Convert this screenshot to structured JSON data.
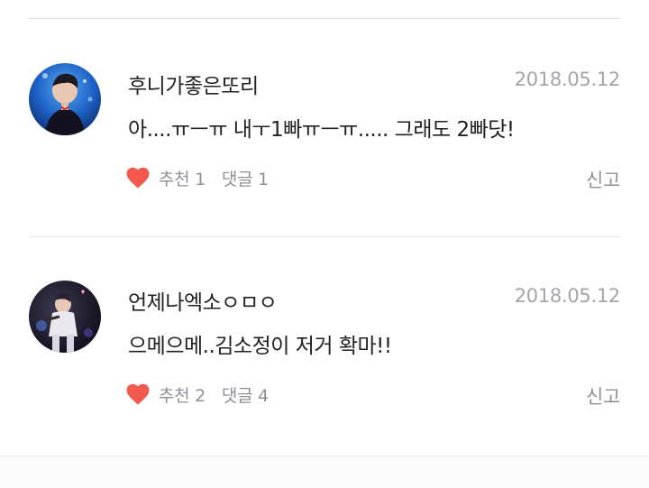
{
  "comments": [
    {
      "author": "후니가좋은또리",
      "date": "2018.05.12",
      "text": "아....ㅠㅡㅠ 내ㅜ1빠ㅠㅡㅠ..... 그래도 2빠닷!",
      "recommend_label": "추천",
      "recommend_count": "1",
      "reply_label": "댓글",
      "reply_count": "1",
      "report_label": "신고"
    },
    {
      "author": "언제나엑소ㅇㅁㅇ",
      "date": "2018.05.12",
      "text": "으메으메..김소정이 저거 확마!!",
      "recommend_label": "추천",
      "recommend_count": "2",
      "reply_label": "댓글",
      "reply_count": "4",
      "report_label": "신고"
    }
  ],
  "icons": {
    "like": "heart-icon",
    "avatar": "avatar-image"
  },
  "colors": {
    "heart": "#f25a4e",
    "text": "#222222",
    "muted": "#8d9196",
    "date": "#a2a6ab",
    "divider": "#e4e6e8"
  }
}
